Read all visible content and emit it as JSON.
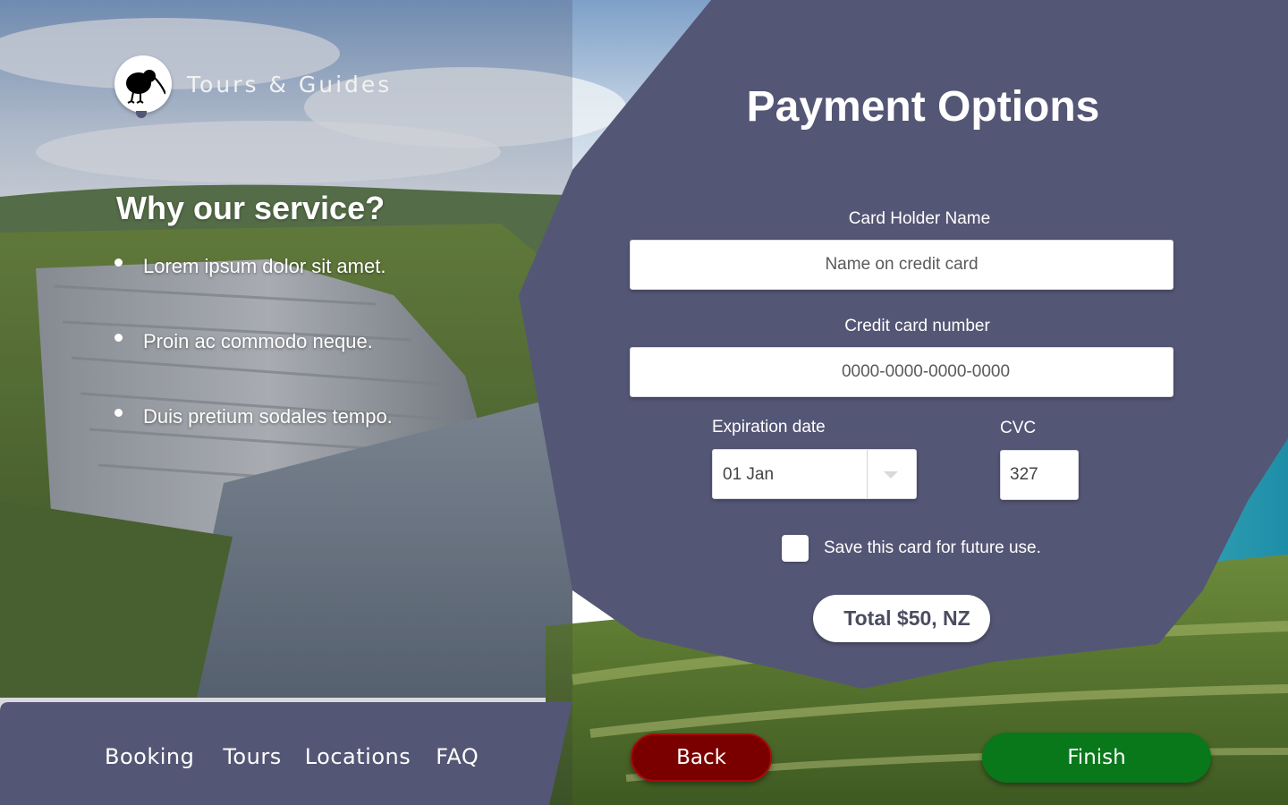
{
  "brand": {
    "name": "Tours & Guides",
    "logo_icon": "kiwi-bird-icon"
  },
  "why": {
    "title": "Why our service?",
    "items": [
      "Lorem ipsum dolor sit amet.",
      "Proin ac commodo neque.",
      "Duis pretium sodales tempo."
    ]
  },
  "nav": {
    "items": [
      "Booking",
      "Tours",
      "Locations",
      "FAQ"
    ]
  },
  "payment": {
    "title": "Payment Options",
    "card_holder": {
      "label": "Card Holder Name",
      "placeholder": "Name on credit card",
      "value": ""
    },
    "card_number": {
      "label": "Credit card number",
      "placeholder": "0000-0000-0000-0000",
      "value": ""
    },
    "expiration": {
      "label": "Expiration date",
      "selected": "01 Jan"
    },
    "cvc": {
      "label": "CVC",
      "value": "327"
    },
    "save_card": {
      "label": "Save this card for future use.",
      "checked": false
    },
    "total": "Total $50, NZ"
  },
  "actions": {
    "back_label": "Back",
    "finish_label": "Finish"
  },
  "colors": {
    "panel": "#545675",
    "back_button": "#7a0000",
    "finish_button": "#08781a"
  }
}
